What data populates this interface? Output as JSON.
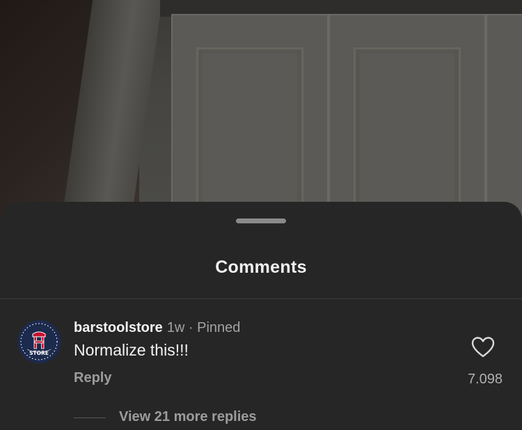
{
  "sheet": {
    "title": "Comments"
  },
  "comment": {
    "username": "barstoolstore",
    "meta": "1w · Pinned",
    "text": "Normalize this!!!",
    "reply_label": "Reply",
    "like_count": "7.098",
    "avatar_logo_text": "STORE",
    "view_replies_label": "View 21 more replies"
  },
  "icons": {
    "like": "heart-outline-icon"
  },
  "colors": {
    "sheet_background": "#262626",
    "avatar_navy": "#1c2a4d",
    "avatar_red": "#c8102e",
    "muted_text": "#9c9c9c"
  }
}
